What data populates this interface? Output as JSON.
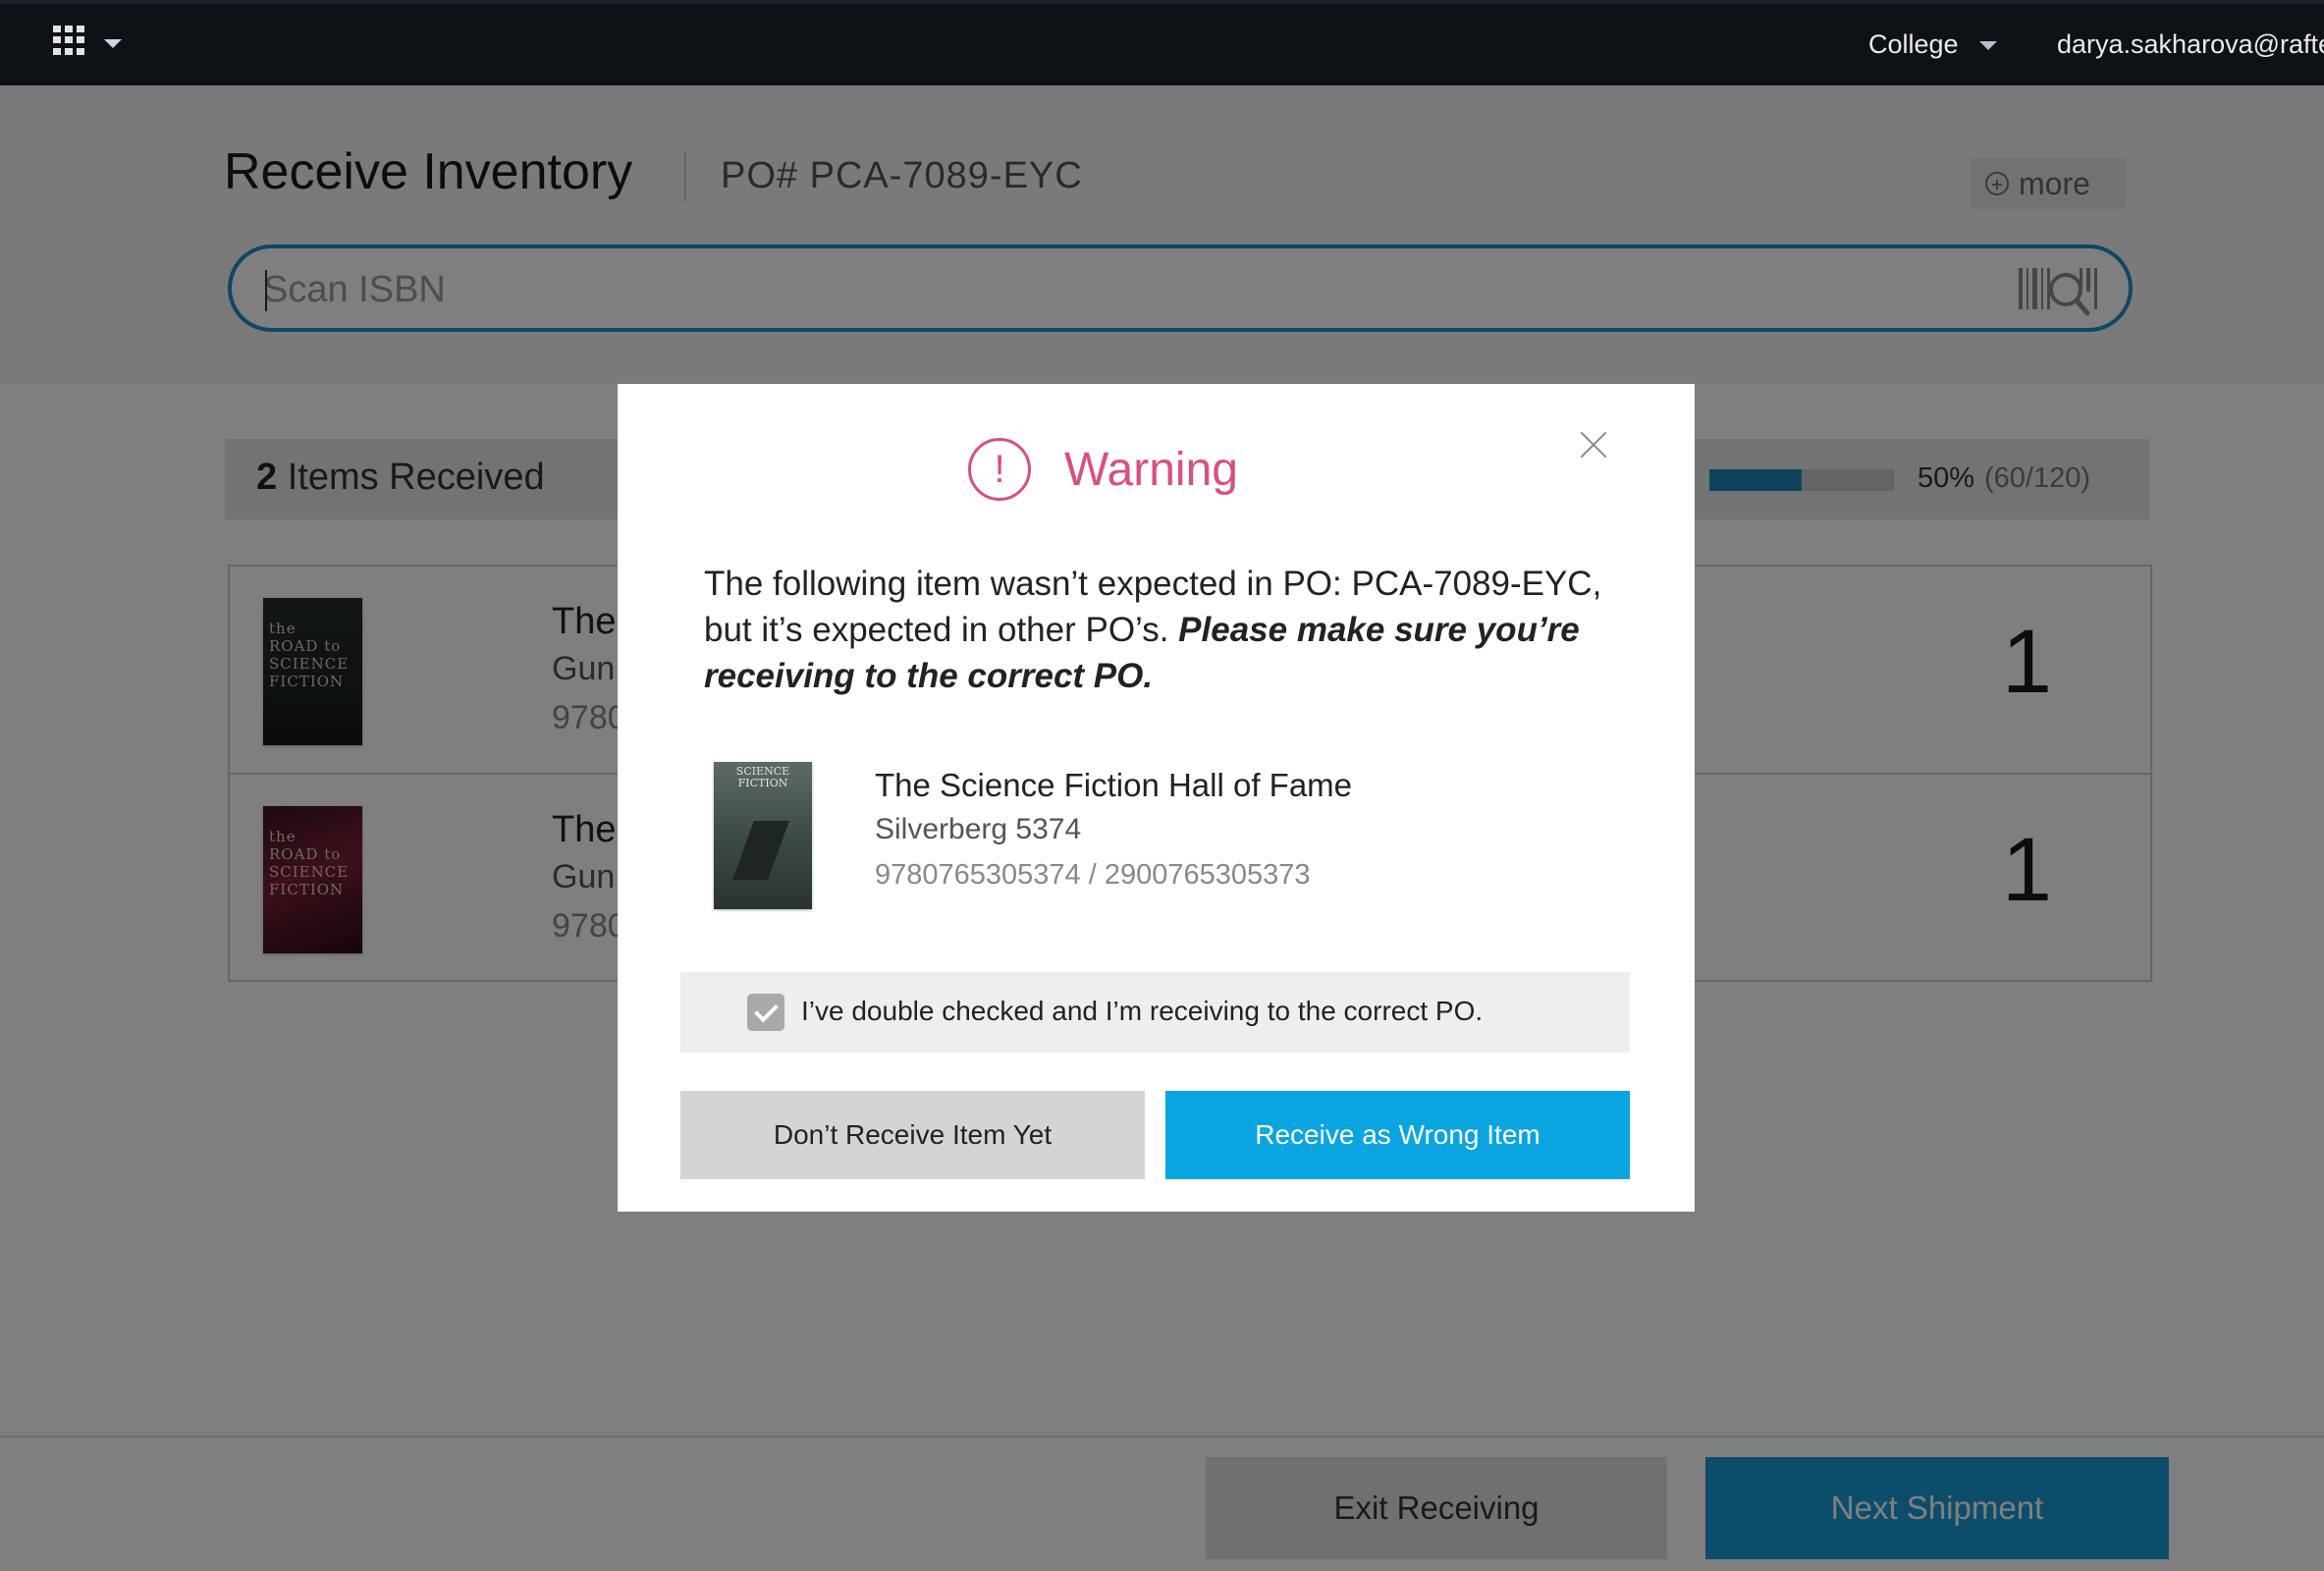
{
  "topbar": {
    "apps_icon": "grid-icon",
    "college_label": "College",
    "user_email": "darya.sakharova@rafter"
  },
  "header": {
    "title": "Receive Inventory",
    "po_number": "PO# PCA-7089-EYC",
    "more_label": "more",
    "scan_placeholder": "Scan ISBN"
  },
  "summary": {
    "count": "2",
    "label": "Items Received",
    "progress_fraction": 0.5,
    "progress_percent": "50%",
    "progress_count": "(60/120)",
    "progress_color": "#1c87b8"
  },
  "items": [
    {
      "title_partial": "The",
      "author_partial": "Gun",
      "isbn_partial": "9780",
      "qty": "1",
      "cover_lines": [
        "the",
        "ROAD to",
        "SCIENCE",
        "FICTION"
      ]
    },
    {
      "title_partial": "The",
      "author_partial": "Gun",
      "isbn_partial": "9780",
      "qty": "1",
      "cover_lines": [
        "the",
        "ROAD to",
        "SCIENCE",
        "FICTION"
      ]
    }
  ],
  "footer": {
    "exit_label": "Exit Receiving",
    "next_label": "Next Shipment"
  },
  "modal": {
    "title": "Warning",
    "icon_symbol": "!",
    "accent_color": "#d94f80",
    "message_plain": "The following item wasn’t expected in PO: PCA-7089-EYC, but it’s expected in other PO’s.",
    "message_emphasis": "Please make sure you’re receiving to the correct PO.",
    "book": {
      "title": "The Science Fiction Hall of Fame",
      "author": "Silverberg 5374",
      "isbn": "9780765305374 / 2900765305373",
      "cover_text": "SCIENCE FICTION"
    },
    "confirm_text": "I’ve double checked and I’m receiving to the correct PO.",
    "confirm_checked": true,
    "dont_receive_label": "Don’t Receive Item Yet",
    "receive_wrong_label": "Receive as Wrong Item",
    "primary_color": "#0aa5e0"
  }
}
